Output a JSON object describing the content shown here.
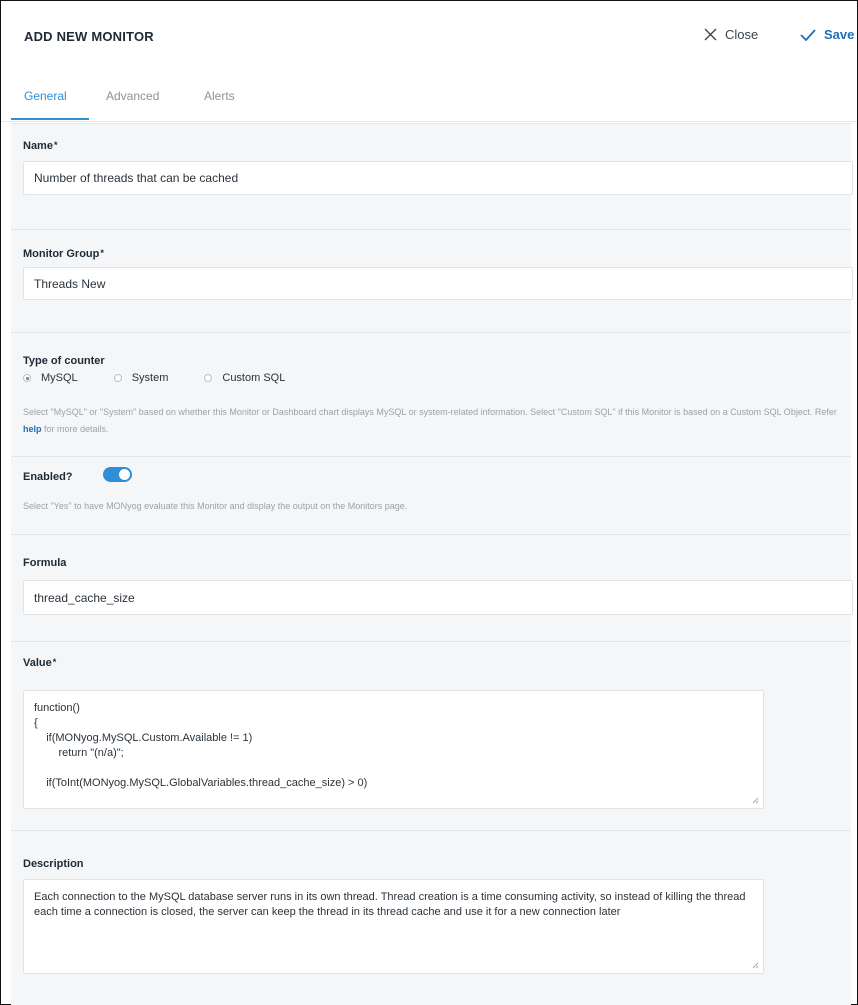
{
  "header": {
    "title": "ADD NEW MONITOR",
    "close_label": "Close",
    "save_label": "Save"
  },
  "tabs": [
    {
      "label": "General",
      "active": true
    },
    {
      "label": "Advanced",
      "active": false
    },
    {
      "label": "Alerts",
      "active": false
    }
  ],
  "name": {
    "label": "Name",
    "required_mark": "*",
    "value": "Number of threads that can be cached"
  },
  "monitor_group": {
    "label": "Monitor Group",
    "required_mark": "*",
    "value": "Threads New"
  },
  "counter_type": {
    "label": "Type of counter",
    "options": [
      {
        "label": "MySQL",
        "selected": true
      },
      {
        "label": "System",
        "selected": false
      },
      {
        "label": "Custom SQL",
        "selected": false
      }
    ],
    "help_before": "Select \"MySQL\" or \"System\" based on whether this Monitor or Dashboard chart displays MySQL or system-related information. Select \"Custom SQL\" if this Monitor is based on a Custom SQL Object. Refer",
    "help_link": "help",
    "help_after": "for more details."
  },
  "enabled": {
    "label": "Enabled?",
    "on": true,
    "help": "Select \"Yes\" to have MONyog evaluate this Monitor and display the output on the Monitors page."
  },
  "formula": {
    "label": "Formula",
    "value": "thread_cache_size"
  },
  "value": {
    "label": "Value",
    "required_mark": "*",
    "code": "function()\n{\n    if(MONyog.MySQL.Custom.Available != 1)\n        return \"(n/a)\";\n\n    if(ToInt(MONyog.MySQL.GlobalVariables.thread_cache_size) > 0)"
  },
  "description": {
    "label": "Description",
    "text": "Each connection to the MySQL database server runs in its own thread. Thread creation is a time consuming activity, so instead of killing the thread each time a connection is closed, the server can keep the thread in its thread cache and use it for a new connection later"
  },
  "colors": {
    "accent": "#2f8fd4",
    "save": "#1d6fb8",
    "section_bg": "#f4f6f7"
  }
}
